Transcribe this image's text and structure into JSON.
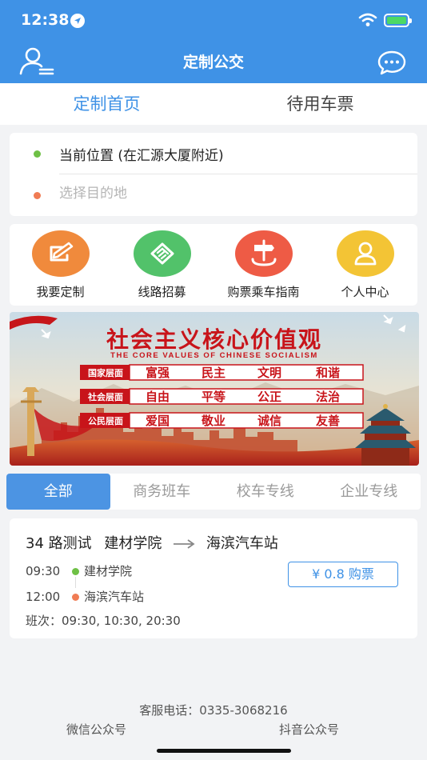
{
  "status_bar": {
    "time": "12:38"
  },
  "header": {
    "title": "定制公交"
  },
  "main_tabs": [
    {
      "label": "定制首页",
      "active": true
    },
    {
      "label": "待用车票",
      "active": false
    }
  ],
  "location": {
    "current": "当前位置 (在汇源大厦附近)",
    "destination_placeholder": "选择目的地",
    "current_dot_color": "#6ec045",
    "dest_dot_color": "#f07c54"
  },
  "quick_actions": [
    {
      "label": "我要定制",
      "icon": "edit-icon",
      "color": "#f08a3c"
    },
    {
      "label": "线路招募",
      "icon": "handshake-icon",
      "color": "#52c26a"
    },
    {
      "label": "购票乘车指南",
      "icon": "signpost-icon",
      "color": "#ee5b45"
    },
    {
      "label": "个人中心",
      "icon": "person-icon",
      "color": "#f3c435"
    }
  ],
  "banner": {
    "title": "社会主义核心价值观",
    "subtitle": "THE CORE VALUES OF CHINESE SOCIALISM",
    "rows": [
      {
        "level": "国家层面",
        "values": [
          "富强",
          "民主",
          "文明",
          "和谐"
        ]
      },
      {
        "level": "社会层面",
        "values": [
          "自由",
          "平等",
          "公正",
          "法治"
        ]
      },
      {
        "level": "公民层面",
        "values": [
          "爱国",
          "敬业",
          "诚信",
          "友善"
        ]
      }
    ]
  },
  "category_tabs": [
    {
      "label": "全部",
      "active": true
    },
    {
      "label": "商务班车",
      "active": false
    },
    {
      "label": "校车专线",
      "active": false
    },
    {
      "label": "企业专线",
      "active": false
    }
  ],
  "route": {
    "name": "34 路测试",
    "from": "建材学院",
    "to": "海滨汽车站",
    "stops": [
      {
        "time": "09:30",
        "name": "建材学院",
        "dot_color": "#6ec045"
      },
      {
        "time": "12:00",
        "name": "海滨汽车站",
        "dot_color": "#f07c54"
      }
    ],
    "schedule_label": "班次：",
    "schedule": "09:30, 10:30, 20:30",
    "price_button": "¥ 0.8 购票"
  },
  "footer": {
    "phone": "客服电话：0335-3068216",
    "wechat": "微信公众号",
    "douyin": "抖音公众号"
  }
}
